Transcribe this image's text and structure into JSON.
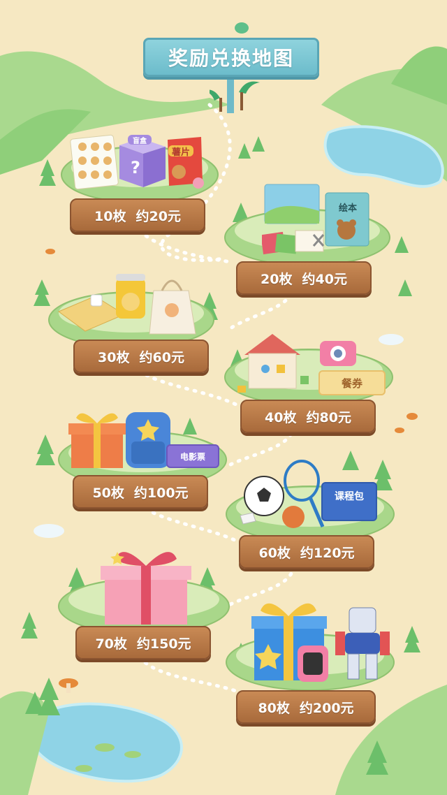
{
  "map": {
    "title": "奖励兑换地图"
  },
  "rewards": [
    {
      "coins": "10枚",
      "value": "约20元"
    },
    {
      "coins": "20枚",
      "value": "约40元"
    },
    {
      "coins": "30枚",
      "value": "约60元"
    },
    {
      "coins": "40枚",
      "value": "约80元"
    },
    {
      "coins": "50枚",
      "value": "约100元"
    },
    {
      "coins": "60枚",
      "value": "约120元"
    },
    {
      "coins": "70枚",
      "value": "约150元"
    },
    {
      "coins": "80枚",
      "value": "约200元"
    }
  ],
  "item_labels": {
    "mystery_box": "盲盒",
    "chips": "薯片",
    "picture_book": "绘本",
    "meal_voucher": "餐券",
    "movie_ticket": "电影票",
    "course_pack": "课程包"
  },
  "colors": {
    "sand": "#f6e8c2",
    "grass": "#a9d78a",
    "water": "#8fd3e6",
    "wood": "#b67644",
    "sign": "#7cc6d3"
  }
}
